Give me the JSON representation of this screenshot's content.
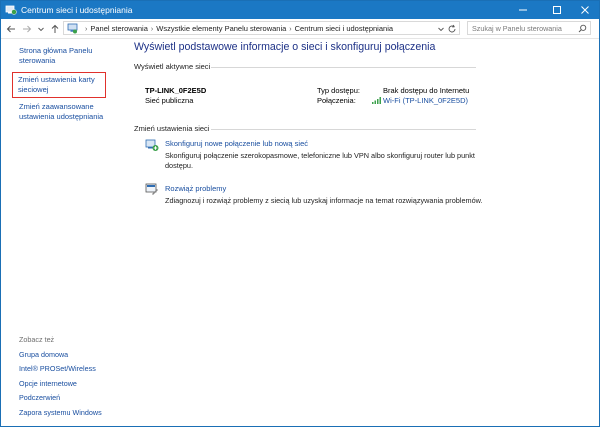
{
  "window": {
    "title": "Centrum sieci i udostępniania"
  },
  "addressbar": {
    "crumbs": [
      "Panel sterowania",
      "Wszystkie elementy Panelu sterowania",
      "Centrum sieci i udostępniania"
    ],
    "search_placeholder": "Szukaj w Panelu sterowania"
  },
  "sidebar": {
    "links": [
      "Strona główna Panelu sterowania",
      "Zmień ustawienia karty sieciowej",
      "Zmień zaawansowane ustawienia udostępniania"
    ],
    "see_also_heading": "Zobacz też",
    "see_also": [
      "Grupa domowa",
      "Intel® PROSet/Wireless",
      "Opcje internetowe",
      "Podczerwień",
      "Zapora systemu Windows"
    ]
  },
  "main": {
    "title": "Wyświetl podstawowe informacje o sieci i skonfiguruj połączenia",
    "active_networks_heading": "Wyświetl aktywne sieci",
    "network": {
      "name": "TP-LINK_0F2E5D",
      "category": "Sieć publiczna",
      "access_type_label": "Typ dostępu:",
      "access_type_value": "Brak dostępu do Internetu",
      "connections_label": "Połączenia:",
      "connections_value": "Wi-Fi (TP-LINK_0F2E5D)"
    },
    "change_settings_heading": "Zmień ustawienia sieci",
    "tasks": [
      {
        "link": "Skonfiguruj nowe połączenie lub nową sieć",
        "desc": "Skonfiguruj połączenie szerokopasmowe, telefoniczne lub VPN albo skonfiguruj router lub punkt dostępu.",
        "icon": "new-connection-icon"
      },
      {
        "link": "Rozwiąż problemy",
        "desc": "Zdiagnozuj i rozwiąż problemy z siecią lub uzyskaj informacje na temat rozwiązywania problemów.",
        "icon": "troubleshoot-icon"
      }
    ]
  },
  "colors": {
    "titlebar": "#1b78c4",
    "link": "#1a4fa0",
    "heading": "#1e3287",
    "selection_border": "#e0312c"
  }
}
